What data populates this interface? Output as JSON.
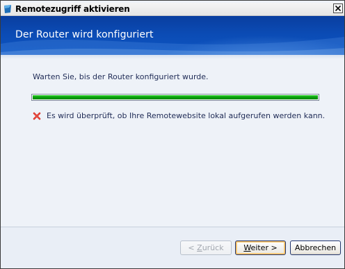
{
  "window": {
    "title": "Remotezugriff aktivieren"
  },
  "banner": {
    "title": "Der Router wird konfiguriert"
  },
  "content": {
    "wait_text": "Warten Sie, bis der Router konfiguriert wurde.",
    "progress_fraction": 1.0,
    "check_text": "Es wird überprüft, ob Ihre Remotewebsite lokal aufgerufen werden kann.",
    "check_status_icon": "error-x-icon"
  },
  "buttons": {
    "back_prefix": "< ",
    "back_mnemonic": "Z",
    "back_suffix": "urück",
    "next_mnemonic": "W",
    "next_suffix": "eiter >",
    "cancel": "Abbrechen"
  },
  "colors": {
    "banner": "#0b4bb4",
    "progress": "#0b9e0b",
    "error_x": "#d7261c"
  }
}
